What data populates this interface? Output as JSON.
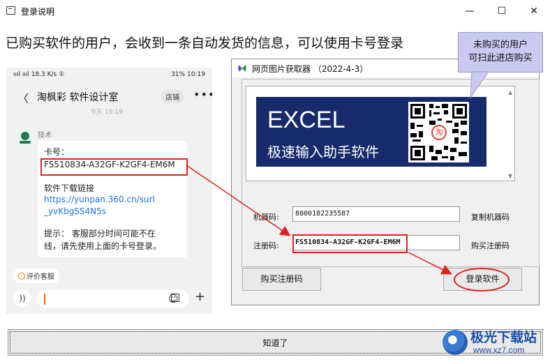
{
  "window": {
    "title": "登录说明",
    "minimize_symbol": "—",
    "maximize_symbol": "☐",
    "close_symbol": "✕"
  },
  "headline": "已购买软件的用户，会收到一条自动发货的信息，可以使用卡号登录",
  "callout": {
    "line1": "未购买的用户",
    "line2": "可扫此进店购买"
  },
  "phone": {
    "status_left": "ıııl ıııl 18.3 K/s ①",
    "status_right": "31% 10:19",
    "back_symbol": "〈",
    "chat_title": "淘枫彩 软件设计室",
    "shop_label": "店铺",
    "more_symbol": "•••",
    "time_label": "今天 10:19",
    "sender": "技术",
    "card_label": "卡号：",
    "card_number": "FS510834-A32GF-K2GF4-EM6M",
    "download_label": "软件下载链接",
    "link_line1": "https://yunpan.360.cn/surl",
    "link_line2": "_yvKbgSS4N5s",
    "tip_line1": "提示：  客服部分时间可能不在",
    "tip_line2": "线，请先使用上面的卡号登录。",
    "eval_label": "评价客服",
    "voice_symbol": "))",
    "emoji_symbol": "☺",
    "plus_symbol": "+"
  },
  "dialog": {
    "title": "网页图片获取器 （2022-4-3）",
    "banner_title": "EXCEL",
    "banner_subtitle": "极速输入助手软件",
    "qr_logo": "淘",
    "scroll_up": "▲",
    "scroll_down": "▼",
    "machine_label": "机器码:",
    "machine_value": "8800182235587",
    "copy_machine": "复制机器码",
    "reg_label": "注册码:",
    "reg_value": "FS510834-A32GF-K2GF4-EM6M",
    "buy_reg_link": "购买注册码",
    "buy_button": "购买注册码",
    "login_button": "登录软件"
  },
  "ok_button": "知道了",
  "watermark": {
    "text": "极光下载站",
    "url": "www.xz7.com"
  },
  "colors": {
    "highlight_red": "#e02020",
    "banner_blue": "#172b6b",
    "callout_purple": "#c9c9f1",
    "link_blue": "#1a73e8"
  }
}
